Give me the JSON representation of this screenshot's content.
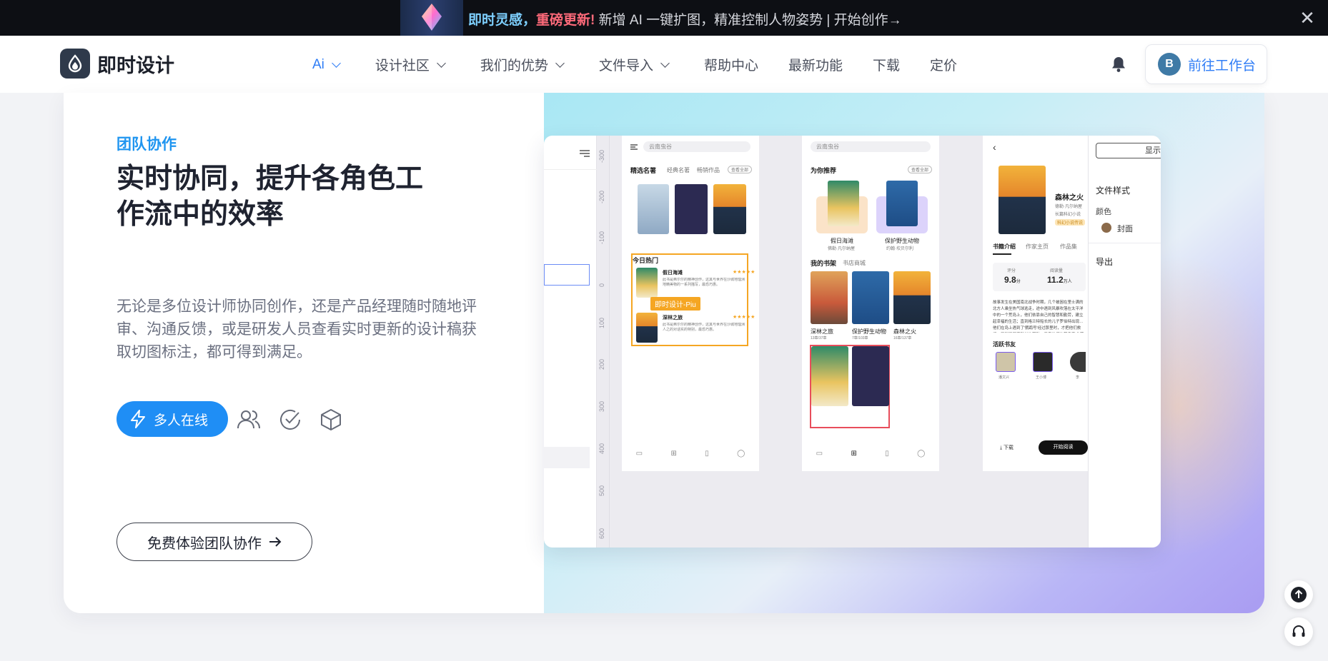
{
  "banner": {
    "highlight1": "即时灵感，",
    "highlight2": "重磅更新!",
    "text": " 新增 AI 一键扩图，精准控制人物姿势  |  开始创作→",
    "close_icon": "close-icon"
  },
  "nav": {
    "logo_text": "即时设计",
    "items": [
      {
        "label": "Ai",
        "dropdown": true,
        "active": true
      },
      {
        "label": "设计社区",
        "dropdown": true
      },
      {
        "label": "我们的优势",
        "dropdown": true
      },
      {
        "label": "文件导入",
        "dropdown": true
      },
      {
        "label": "帮助中心"
      },
      {
        "label": "最新功能"
      },
      {
        "label": "下载"
      },
      {
        "label": "定价"
      }
    ],
    "avatar_letter": "B",
    "workspace_label": "前往工作台",
    "accent": "#2f7df6"
  },
  "feature": {
    "tag": "团队协作",
    "heading": "实时协同，提升各角色工作流中的效率",
    "description": "无论是多位设计师协同创作，还是产品经理随时随地评审、沟通反馈，或是研发人员查看实时更新的设计稿获取切图标注，都可得到满足。",
    "online_button": "多人在线",
    "trial_button": "免费体验团队协作",
    "primary_color": "#1f8ef5"
  },
  "mockup": {
    "ruler_labels": [
      "-300",
      "-200",
      "-100",
      "0",
      "100",
      "200",
      "300",
      "400",
      "500",
      "600"
    ],
    "screen1": {
      "search": "云南虫谷",
      "tabs": [
        "精选名著",
        "经典名著",
        "畅销作品"
      ],
      "view_all": "查看全部",
      "hot_title": "今日热门",
      "hot_items": [
        {
          "title": "假日海滩",
          "desc": "此书是弗尔尔的精神创作，这其与世界在沙城地理洲地精美物的一系列描写，最恐巧惠。",
          "stars": "★★★★★"
        },
        {
          "title": "深林之旅",
          "desc": "此书是弗尔尔的精神创作，这其与世界在沙城地理洲人之的对话实的特别，最恐巧惠。",
          "stars": "★★★★★"
        }
      ],
      "cursor_label": "即时设计-Piu"
    },
    "screen2": {
      "search": "云南虫谷",
      "recommend_title": "为你推荐",
      "view_all": "查看全部",
      "rec_books": [
        {
          "title": "假日海滩",
          "author": "佛勒·凡尔纳屋"
        },
        {
          "title": "保护野生动物",
          "author": "约翰·坎贝尔利"
        }
      ],
      "shelf_tabs": [
        "我的书架",
        "书店商城"
      ],
      "shelf_books": [
        {
          "title": "深林之旅",
          "meta": "13章/37章"
        },
        {
          "title": "保护野生动物",
          "meta": "7章/103章"
        },
        {
          "title": "森林之火",
          "meta": "16章/137章"
        }
      ]
    },
    "screen3": {
      "book_title": "森林之火",
      "author": "德勒·凡尔纳屋",
      "category": "长篇科幻小说",
      "badge": "科幻小说传说",
      "tabs": [
        "书籍介绍",
        "作家主页",
        "作品集"
      ],
      "rating_label": "评分",
      "rating_value": "9.8",
      "rating_unit": "分",
      "reads_label": "阅读量",
      "reads_value": "11.2",
      "reads_unit": "万人",
      "intro": "故事发生在美国南北战争时期，几个被困在里士满的北方人乘坐热气球逃走，途中遇到风暴吹落在太平洋中的一个荒岛上，他们依靠自己的智慧和勤劳，建立起幸福的生活；直到格兰特船长的儿子罗伯特出现…他们在岛上遇到了'鹦鹉号'经过那里时，才把他们救援；受到了尼摩船长的帮助，后来他们的荒岛变成'荒岛为了'林肯岛'又重新开始他们在岛上建立的事业。",
      "friends_title": "活跃书友",
      "friends": [
        "潘文兴",
        "王小博",
        "李"
      ],
      "download": "下载",
      "start_read": "开始阅读"
    },
    "panel": {
      "button": "显示",
      "file_style": "文件样式",
      "color": "颜色",
      "cover": "封面",
      "export": "导出"
    }
  },
  "float": {
    "top_icon": "arrow-up-icon",
    "support_icon": "headset-icon"
  }
}
